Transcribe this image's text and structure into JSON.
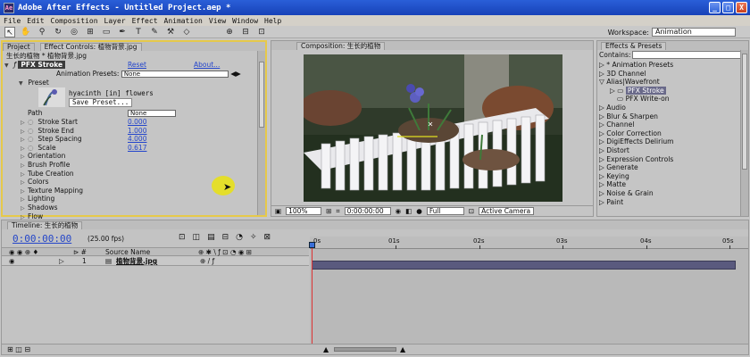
{
  "window": {
    "title": "Adobe After Effects - Untitled Project.aep *",
    "controls": [
      "_",
      "□",
      "X"
    ]
  },
  "menu": [
    "File",
    "Edit",
    "Composition",
    "Layer",
    "Effect",
    "Animation",
    "View",
    "Window",
    "Help"
  ],
  "workspace": {
    "label": "Workspace:",
    "value": "Animation"
  },
  "left_tabs": {
    "project": "Project",
    "effect_controls": "Effect Controls: 植物背景.jpg"
  },
  "effect_controls": {
    "breadcrumb": "生长的植物 * 植物背景.jpg",
    "effect_name": "PFX Stroke",
    "reset": "Reset",
    "about": "About...",
    "animation_presets_label": "Animation Presets:",
    "animation_presets_value": "None",
    "preset_label": "Preset",
    "preset_text": "hyacinth  [in]  flowers",
    "save_preset": "Save Preset...",
    "path_label": "Path",
    "path_value": "None",
    "params": [
      {
        "label": "Stroke Start",
        "value": "0.000"
      },
      {
        "label": "Stroke End",
        "value": "1.000"
      },
      {
        "label": "Step Spacing",
        "value": "4.000"
      },
      {
        "label": "Scale",
        "value": "0.617"
      }
    ],
    "groups": [
      "Orientation",
      "Brush Profile",
      "Tube Creation",
      "Colors",
      "Texture Mapping",
      "Lighting",
      "Shadows",
      "Flow"
    ]
  },
  "composition": {
    "tab": "Composition: 生长的植物",
    "zoom": "100%",
    "timecode": "0:00:00:00",
    "resolution": "Full",
    "camera": "Active Camera"
  },
  "effects_presets": {
    "tab": "Effects & Presets",
    "contains_label": "Contains:",
    "items": [
      {
        "label": "* Animation Presets",
        "indent": 0
      },
      {
        "label": "3D Channel",
        "indent": 0
      },
      {
        "label": "Alias|Wavefront",
        "indent": 0,
        "open": true
      },
      {
        "label": "PFX Stroke",
        "indent": 1,
        "selected": true
      },
      {
        "label": "PFX Write-on",
        "indent": 1
      },
      {
        "label": "Audio",
        "indent": 0
      },
      {
        "label": "Blur & Sharpen",
        "indent": 0
      },
      {
        "label": "Channel",
        "indent": 0
      },
      {
        "label": "Color Correction",
        "indent": 0
      },
      {
        "label": "DigiEffects Delirium",
        "indent": 0
      },
      {
        "label": "Distort",
        "indent": 0
      },
      {
        "label": "Expression Controls",
        "indent": 0
      },
      {
        "label": "Generate",
        "indent": 0
      },
      {
        "label": "Keying",
        "indent": 0
      },
      {
        "label": "Matte",
        "indent": 0
      },
      {
        "label": "Noise & Grain",
        "indent": 0
      },
      {
        "label": "Paint",
        "indent": 0
      }
    ]
  },
  "timeline": {
    "tab": "Timeline: 生长的植物",
    "timecode": "0:00:00:00",
    "fps": "(25.00 fps)",
    "source_name_header": "Source Name",
    "layer_index": "1",
    "layer_name": "植物背景.jpg",
    "ruler_labels": [
      "0s",
      "01s",
      "02s",
      "03s",
      "04s",
      "05s"
    ]
  }
}
